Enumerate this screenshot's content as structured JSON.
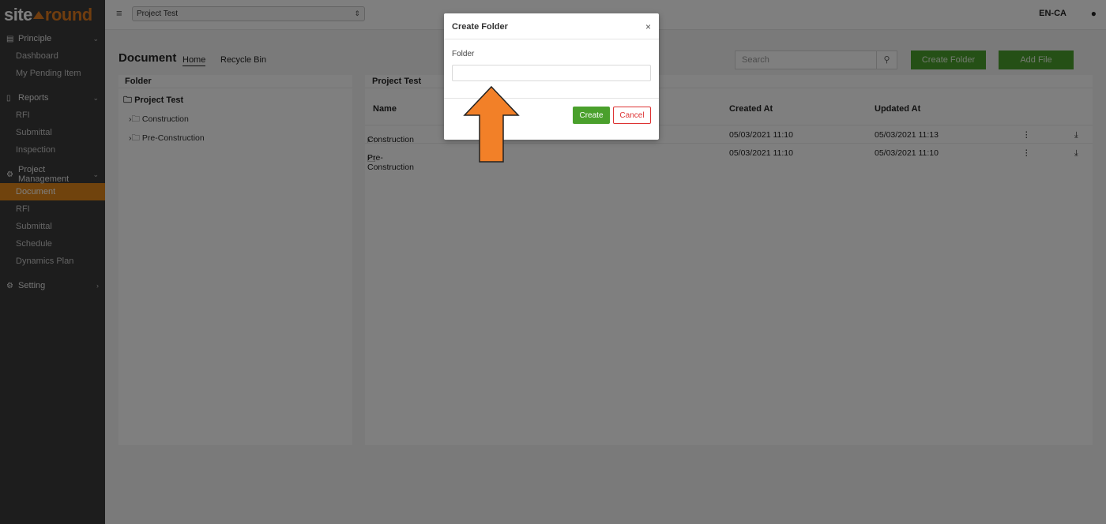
{
  "logo": {
    "part1": "site",
    "part2": "round"
  },
  "sidebar": {
    "sections": [
      {
        "label": "Principle",
        "icon": "table-icon",
        "items": [
          "Dashboard",
          "My Pending Item"
        ]
      },
      {
        "label": "Reports",
        "icon": "clipboard-icon",
        "items": [
          "RFI",
          "Submittal",
          "Inspection"
        ]
      },
      {
        "label": "Project Management",
        "icon": "gears-icon",
        "items": [
          "Document",
          "RFI",
          "Submittal",
          "Schedule",
          "Dynamics Plan"
        ],
        "active_item": "Document"
      },
      {
        "label": "Setting",
        "icon": "gear-icon",
        "items": []
      }
    ]
  },
  "header": {
    "project_select_value": "Project Test",
    "language": "EN-CA"
  },
  "page": {
    "title": "Document",
    "tabs": [
      "Home",
      "Recycle Bin"
    ],
    "search_placeholder": "Search",
    "create_folder_label": "Create Folder",
    "add_file_label": "Add File"
  },
  "folder_panel": {
    "header": "Folder",
    "root": "Project Test",
    "children": [
      "Construction",
      "Pre-Construction"
    ]
  },
  "list_panel": {
    "header": "Project Test",
    "columns": [
      "Name",
      "Created At",
      "Updated At"
    ],
    "rows": [
      {
        "name": "Construction",
        "created": "05/03/2021 11:10",
        "updated": "05/03/2021 11:13"
      },
      {
        "name": "Pre-Construction",
        "created": "05/03/2021 11:10",
        "updated": "05/03/2021 11:10"
      }
    ]
  },
  "modal": {
    "title": "Create Folder",
    "close": "×",
    "field_label": "Folder",
    "field_value": "",
    "create_label": "Create",
    "cancel_label": "Cancel"
  },
  "colors": {
    "accent_orange": "#e0871b",
    "green": "#4aa02c",
    "sidebar_bg": "#3a3a3a",
    "arrow": "#f28028"
  }
}
